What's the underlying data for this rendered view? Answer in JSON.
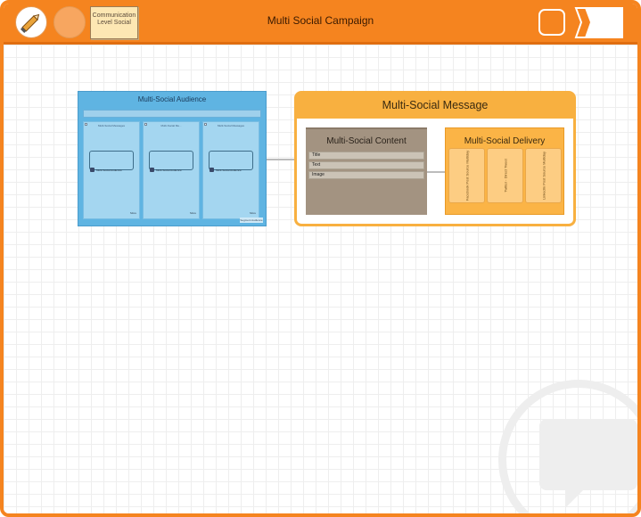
{
  "window": {
    "title": "Multi Social Campaign"
  },
  "toolbar": {
    "note_label": "Communication Level Social"
  },
  "audience": {
    "title": "Multi-Social Audience",
    "columns": [
      {
        "header": "Multi-Social Messages",
        "label": "Multi-Social Audience",
        "more": "More"
      },
      {
        "header": "Multi-Social Me...",
        "label": "Multi-Social Audience",
        "more": "More"
      },
      {
        "header": "Multi-Social Messages",
        "label": "Multi-Social Audience",
        "more": "More"
      }
    ],
    "badge": "Segment Audience"
  },
  "message": {
    "title": "Multi-Social Message",
    "content": {
      "title": "Multi-Social Content",
      "fields": [
        "Title",
        "Text",
        "Image"
      ]
    },
    "delivery": {
      "title": "Multi-Social Delivery",
      "cards": [
        "Facebook Post Source Multiday",
        "Twitter - Direct Tweet",
        "LinkedIn Post Source Multiday"
      ]
    }
  }
}
